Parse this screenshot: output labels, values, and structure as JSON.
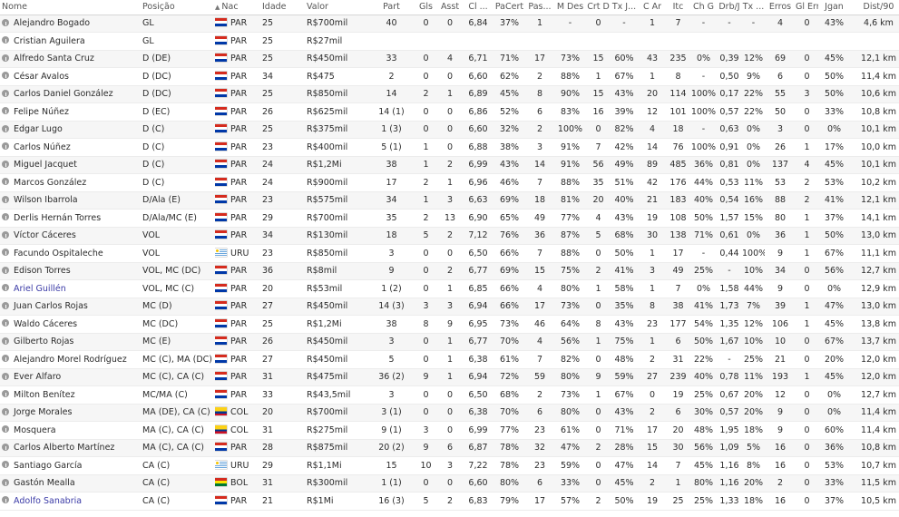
{
  "headers": {
    "nome": "Nome",
    "posicao": "Posição",
    "nac": "Nac",
    "idade": "Idade",
    "valor": "Valor",
    "part": "Part",
    "gls": "Gls",
    "asst": "Asst",
    "cl": "Cl ...",
    "pacert": "PaCert",
    "pas": "Pas...",
    "mdes": "M Des",
    "crt": "Crt D",
    "txj": "Tx J...",
    "car": "C Ar",
    "itc": "Itc",
    "chg": "Ch G",
    "drbj": "Drb/J",
    "tx": "Tx ...",
    "erros": "Erros",
    "glerr": "Gl Err",
    "jgan": "Jgan",
    "dist": "Dist/90"
  },
  "sort_icon": "sort-arrow-icon",
  "players": [
    {
      "name": "Alejandro Bogado",
      "pos": "GL",
      "flag": "par",
      "nat": "PAR",
      "age": "25",
      "value": "R$700mil",
      "apps": "40",
      "gls": "0",
      "asst": "0",
      "rating": "6,84",
      "pass_pct": "37%",
      "pas": "1",
      "mdes": "-",
      "crt": "0",
      "txj": "-",
      "car": "1",
      "itc": "7",
      "chg": "-",
      "drbj": "-",
      "tx": "-",
      "errors": "4",
      "glerr": "0",
      "won": "43%",
      "dist": "4,6 km",
      "link": false
    },
    {
      "name": "Cristian Aguilera",
      "pos": "GL",
      "flag": "par",
      "nat": "PAR",
      "age": "25",
      "value": "R$27mil",
      "apps": "",
      "gls": "",
      "asst": "",
      "rating": "",
      "pass_pct": "",
      "pas": "",
      "mdes": "",
      "crt": "",
      "txj": "",
      "car": "",
      "itc": "",
      "chg": "",
      "drbj": "",
      "tx": "",
      "errors": "",
      "glerr": "",
      "won": "",
      "dist": "",
      "link": false
    },
    {
      "name": "Alfredo Santa Cruz",
      "pos": "D (DE)",
      "flag": "par",
      "nat": "PAR",
      "age": "25",
      "value": "R$450mil",
      "apps": "33",
      "gls": "0",
      "asst": "4",
      "rating": "6,71",
      "pass_pct": "71%",
      "pas": "17",
      "mdes": "73%",
      "crt": "15",
      "txj": "60%",
      "car": "43",
      "itc": "235",
      "chg": "0%",
      "drbj": "0,39",
      "tx": "12%",
      "errors": "69",
      "glerr": "0",
      "won": "45%",
      "dist": "12,1 km",
      "link": false
    },
    {
      "name": "César Avalos",
      "pos": "D (DC)",
      "flag": "par",
      "nat": "PAR",
      "age": "34",
      "value": "R$475",
      "apps": "2",
      "gls": "0",
      "asst": "0",
      "rating": "6,60",
      "pass_pct": "62%",
      "pas": "2",
      "mdes": "88%",
      "crt": "1",
      "txj": "67%",
      "car": "1",
      "itc": "8",
      "chg": "-",
      "drbj": "0,50",
      "tx": "9%",
      "errors": "6",
      "glerr": "0",
      "won": "50%",
      "dist": "11,4 km",
      "link": false
    },
    {
      "name": "Carlos Daniel González",
      "pos": "D (DC)",
      "flag": "par",
      "nat": "PAR",
      "age": "25",
      "value": "R$850mil",
      "apps": "14",
      "gls": "2",
      "asst": "1",
      "rating": "6,89",
      "pass_pct": "45%",
      "pas": "8",
      "mdes": "90%",
      "crt": "15",
      "txj": "43%",
      "car": "20",
      "itc": "114",
      "chg": "100%",
      "drbj": "0,17",
      "tx": "22%",
      "errors": "55",
      "glerr": "3",
      "won": "50%",
      "dist": "10,6 km",
      "link": false
    },
    {
      "name": "Felipe Núñez",
      "pos": "D (EC)",
      "flag": "par",
      "nat": "PAR",
      "age": "26",
      "value": "R$625mil",
      "apps": "14 (1)",
      "gls": "0",
      "asst": "0",
      "rating": "6,86",
      "pass_pct": "52%",
      "pas": "6",
      "mdes": "83%",
      "crt": "16",
      "txj": "39%",
      "car": "12",
      "itc": "101",
      "chg": "100%",
      "drbj": "0,57",
      "tx": "22%",
      "errors": "50",
      "glerr": "0",
      "won": "33%",
      "dist": "10,8 km",
      "link": false
    },
    {
      "name": "Edgar Lugo",
      "pos": "D (C)",
      "flag": "par",
      "nat": "PAR",
      "age": "25",
      "value": "R$375mil",
      "apps": "1 (3)",
      "gls": "0",
      "asst": "0",
      "rating": "6,60",
      "pass_pct": "32%",
      "pas": "2",
      "mdes": "100%",
      "crt": "0",
      "txj": "82%",
      "car": "4",
      "itc": "18",
      "chg": "-",
      "drbj": "0,63",
      "tx": "0%",
      "errors": "3",
      "glerr": "0",
      "won": "0%",
      "dist": "10,1 km",
      "link": false
    },
    {
      "name": "Carlos Núñez",
      "pos": "D (C)",
      "flag": "par",
      "nat": "PAR",
      "age": "23",
      "value": "R$400mil",
      "apps": "5 (1)",
      "gls": "1",
      "asst": "0",
      "rating": "6,88",
      "pass_pct": "38%",
      "pas": "3",
      "mdes": "91%",
      "crt": "7",
      "txj": "42%",
      "car": "14",
      "itc": "76",
      "chg": "100%",
      "drbj": "0,91",
      "tx": "0%",
      "errors": "26",
      "glerr": "1",
      "won": "17%",
      "dist": "10,0 km",
      "link": false
    },
    {
      "name": "Miguel Jacquet",
      "pos": "D (C)",
      "flag": "par",
      "nat": "PAR",
      "age": "24",
      "value": "R$1,2Mi",
      "apps": "38",
      "gls": "1",
      "asst": "2",
      "rating": "6,99",
      "pass_pct": "43%",
      "pas": "14",
      "mdes": "91%",
      "crt": "56",
      "txj": "49%",
      "car": "89",
      "itc": "485",
      "chg": "36%",
      "drbj": "0,81",
      "tx": "0%",
      "errors": "137",
      "glerr": "4",
      "won": "45%",
      "dist": "10,1 km",
      "link": false
    },
    {
      "name": "Marcos González",
      "pos": "D (C)",
      "flag": "par",
      "nat": "PAR",
      "age": "24",
      "value": "R$900mil",
      "apps": "17",
      "gls": "2",
      "asst": "1",
      "rating": "6,96",
      "pass_pct": "46%",
      "pas": "7",
      "mdes": "88%",
      "crt": "35",
      "txj": "51%",
      "car": "42",
      "itc": "176",
      "chg": "44%",
      "drbj": "0,53",
      "tx": "11%",
      "errors": "53",
      "glerr": "2",
      "won": "53%",
      "dist": "10,2 km",
      "link": false
    },
    {
      "name": "Wilson Ibarrola",
      "pos": "D/Ala (E)",
      "flag": "par",
      "nat": "PAR",
      "age": "23",
      "value": "R$575mil",
      "apps": "34",
      "gls": "1",
      "asst": "3",
      "rating": "6,63",
      "pass_pct": "69%",
      "pas": "18",
      "mdes": "81%",
      "crt": "20",
      "txj": "40%",
      "car": "21",
      "itc": "183",
      "chg": "40%",
      "drbj": "0,54",
      "tx": "16%",
      "errors": "88",
      "glerr": "2",
      "won": "41%",
      "dist": "12,1 km",
      "link": false
    },
    {
      "name": "Derlis Hernán Torres",
      "pos": "D/Ala/MC (E)",
      "flag": "par",
      "nat": "PAR",
      "age": "29",
      "value": "R$700mil",
      "apps": "35",
      "gls": "2",
      "asst": "13",
      "rating": "6,90",
      "pass_pct": "65%",
      "pas": "49",
      "mdes": "77%",
      "crt": "4",
      "txj": "43%",
      "car": "19",
      "itc": "108",
      "chg": "50%",
      "drbj": "1,57",
      "tx": "15%",
      "errors": "80",
      "glerr": "1",
      "won": "37%",
      "dist": "14,1 km",
      "link": false
    },
    {
      "name": "Víctor Cáceres",
      "pos": "VOL",
      "flag": "par",
      "nat": "PAR",
      "age": "34",
      "value": "R$130mil",
      "apps": "18",
      "gls": "5",
      "asst": "2",
      "rating": "7,12",
      "pass_pct": "76%",
      "pas": "36",
      "mdes": "87%",
      "crt": "5",
      "txj": "68%",
      "car": "30",
      "itc": "138",
      "chg": "71%",
      "drbj": "0,61",
      "tx": "0%",
      "errors": "36",
      "glerr": "1",
      "won": "50%",
      "dist": "13,0 km",
      "link": false
    },
    {
      "name": "Facundo Ospitaleche",
      "pos": "VOL",
      "flag": "uru",
      "nat": "URU",
      "age": "23",
      "value": "R$850mil",
      "apps": "3",
      "gls": "0",
      "asst": "0",
      "rating": "6,50",
      "pass_pct": "66%",
      "pas": "7",
      "mdes": "88%",
      "crt": "0",
      "txj": "50%",
      "car": "1",
      "itc": "17",
      "chg": "-",
      "drbj": "0,44",
      "tx": "100%",
      "errors": "9",
      "glerr": "1",
      "won": "67%",
      "dist": "11,1 km",
      "link": false
    },
    {
      "name": "Edison Torres",
      "pos": "VOL, MC (DC)",
      "flag": "par",
      "nat": "PAR",
      "age": "36",
      "value": "R$8mil",
      "apps": "9",
      "gls": "0",
      "asst": "2",
      "rating": "6,77",
      "pass_pct": "69%",
      "pas": "15",
      "mdes": "75%",
      "crt": "2",
      "txj": "41%",
      "car": "3",
      "itc": "49",
      "chg": "25%",
      "drbj": "-",
      "tx": "10%",
      "errors": "34",
      "glerr": "0",
      "won": "56%",
      "dist": "12,7 km",
      "link": false
    },
    {
      "name": "Ariel Guillén",
      "pos": "VOL, MC (C)",
      "flag": "par",
      "nat": "PAR",
      "age": "20",
      "value": "R$53mil",
      "apps": "1 (2)",
      "gls": "0",
      "asst": "1",
      "rating": "6,85",
      "pass_pct": "66%",
      "pas": "4",
      "mdes": "80%",
      "crt": "1",
      "txj": "58%",
      "car": "1",
      "itc": "7",
      "chg": "0%",
      "drbj": "1,58",
      "tx": "44%",
      "errors": "9",
      "glerr": "0",
      "won": "0%",
      "dist": "12,9 km",
      "link": true
    },
    {
      "name": "Juan Carlos Rojas",
      "pos": "MC (D)",
      "flag": "par",
      "nat": "PAR",
      "age": "27",
      "value": "R$450mil",
      "apps": "14 (3)",
      "gls": "3",
      "asst": "3",
      "rating": "6,94",
      "pass_pct": "66%",
      "pas": "17",
      "mdes": "73%",
      "crt": "0",
      "txj": "35%",
      "car": "8",
      "itc": "38",
      "chg": "41%",
      "drbj": "1,73",
      "tx": "7%",
      "errors": "39",
      "glerr": "1",
      "won": "47%",
      "dist": "13,0 km",
      "link": false
    },
    {
      "name": "Waldo Cáceres",
      "pos": "MC (DC)",
      "flag": "par",
      "nat": "PAR",
      "age": "25",
      "value": "R$1,2Mi",
      "apps": "38",
      "gls": "8",
      "asst": "9",
      "rating": "6,95",
      "pass_pct": "73%",
      "pas": "46",
      "mdes": "64%",
      "crt": "8",
      "txj": "43%",
      "car": "23",
      "itc": "177",
      "chg": "54%",
      "drbj": "1,35",
      "tx": "12%",
      "errors": "106",
      "glerr": "1",
      "won": "45%",
      "dist": "13,8 km",
      "link": false
    },
    {
      "name": "Gilberto Rojas",
      "pos": "MC (E)",
      "flag": "par",
      "nat": "PAR",
      "age": "26",
      "value": "R$450mil",
      "apps": "3",
      "gls": "0",
      "asst": "1",
      "rating": "6,77",
      "pass_pct": "70%",
      "pas": "4",
      "mdes": "56%",
      "crt": "1",
      "txj": "75%",
      "car": "1",
      "itc": "6",
      "chg": "50%",
      "drbj": "1,67",
      "tx": "10%",
      "errors": "10",
      "glerr": "0",
      "won": "67%",
      "dist": "13,7 km",
      "link": false
    },
    {
      "name": "Alejandro Morel Rodríguez",
      "pos": "MC (C), MA (DC)",
      "flag": "par",
      "nat": "PAR",
      "age": "27",
      "value": "R$450mil",
      "apps": "5",
      "gls": "0",
      "asst": "1",
      "rating": "6,38",
      "pass_pct": "61%",
      "pas": "7",
      "mdes": "82%",
      "crt": "0",
      "txj": "48%",
      "car": "2",
      "itc": "31",
      "chg": "22%",
      "drbj": "-",
      "tx": "25%",
      "errors": "21",
      "glerr": "0",
      "won": "20%",
      "dist": "12,0 km",
      "link": false
    },
    {
      "name": "Ever Alfaro",
      "pos": "MC (C), CA (C)",
      "flag": "par",
      "nat": "PAR",
      "age": "31",
      "value": "R$475mil",
      "apps": "36 (2)",
      "gls": "9",
      "asst": "1",
      "rating": "6,94",
      "pass_pct": "72%",
      "pas": "59",
      "mdes": "80%",
      "crt": "9",
      "txj": "59%",
      "car": "27",
      "itc": "239",
      "chg": "40%",
      "drbj": "0,78",
      "tx": "11%",
      "errors": "193",
      "glerr": "1",
      "won": "45%",
      "dist": "12,0 km",
      "link": false
    },
    {
      "name": "Milton Benítez",
      "pos": "MC/MA (C)",
      "flag": "par",
      "nat": "PAR",
      "age": "33",
      "value": "R$43,5mil",
      "apps": "3",
      "gls": "0",
      "asst": "0",
      "rating": "6,50",
      "pass_pct": "68%",
      "pas": "2",
      "mdes": "73%",
      "crt": "1",
      "txj": "67%",
      "car": "0",
      "itc": "19",
      "chg": "25%",
      "drbj": "0,67",
      "tx": "20%",
      "errors": "12",
      "glerr": "0",
      "won": "0%",
      "dist": "12,7 km",
      "link": false
    },
    {
      "name": "Jorge Morales",
      "pos": "MA (DE), CA (C)",
      "flag": "col",
      "nat": "COL",
      "age": "20",
      "value": "R$700mil",
      "apps": "3 (1)",
      "gls": "0",
      "asst": "0",
      "rating": "6,38",
      "pass_pct": "70%",
      "pas": "6",
      "mdes": "80%",
      "crt": "0",
      "txj": "43%",
      "car": "2",
      "itc": "6",
      "chg": "30%",
      "drbj": "0,57",
      "tx": "20%",
      "errors": "9",
      "glerr": "0",
      "won": "0%",
      "dist": "11,4 km",
      "link": false
    },
    {
      "name": "Mosquera",
      "pos": "MA (C), CA (C)",
      "flag": "col",
      "nat": "COL",
      "age": "31",
      "value": "R$275mil",
      "apps": "9 (1)",
      "gls": "3",
      "asst": "0",
      "rating": "6,99",
      "pass_pct": "77%",
      "pas": "23",
      "mdes": "61%",
      "crt": "0",
      "txj": "71%",
      "car": "17",
      "itc": "20",
      "chg": "48%",
      "drbj": "1,95",
      "tx": "18%",
      "errors": "9",
      "glerr": "0",
      "won": "60%",
      "dist": "11,4 km",
      "link": false
    },
    {
      "name": "Carlos Alberto Martínez",
      "pos": "MA (C), CA (C)",
      "flag": "par",
      "nat": "PAR",
      "age": "28",
      "value": "R$875mil",
      "apps": "20 (2)",
      "gls": "9",
      "asst": "6",
      "rating": "6,87",
      "pass_pct": "78%",
      "pas": "32",
      "mdes": "47%",
      "crt": "2",
      "txj": "28%",
      "car": "15",
      "itc": "30",
      "chg": "56%",
      "drbj": "1,09",
      "tx": "5%",
      "errors": "16",
      "glerr": "0",
      "won": "36%",
      "dist": "10,8 km",
      "link": false
    },
    {
      "name": "Santiago García",
      "pos": "CA (C)",
      "flag": "uru",
      "nat": "URU",
      "age": "29",
      "value": "R$1,1Mi",
      "apps": "15",
      "gls": "10",
      "asst": "3",
      "rating": "7,22",
      "pass_pct": "78%",
      "pas": "23",
      "mdes": "59%",
      "crt": "0",
      "txj": "47%",
      "car": "14",
      "itc": "7",
      "chg": "45%",
      "drbj": "1,16",
      "tx": "8%",
      "errors": "16",
      "glerr": "0",
      "won": "53%",
      "dist": "10,7 km",
      "link": false
    },
    {
      "name": "Gastón Mealla",
      "pos": "CA (C)",
      "flag": "bol",
      "nat": "BOL",
      "age": "31",
      "value": "R$300mil",
      "apps": "1 (1)",
      "gls": "0",
      "asst": "0",
      "rating": "6,60",
      "pass_pct": "80%",
      "pas": "6",
      "mdes": "33%",
      "crt": "0",
      "txj": "45%",
      "car": "2",
      "itc": "1",
      "chg": "80%",
      "drbj": "1,16",
      "tx": "20%",
      "errors": "2",
      "glerr": "0",
      "won": "33%",
      "dist": "11,5 km",
      "link": false
    },
    {
      "name": "Adolfo Sanabria",
      "pos": "CA (C)",
      "flag": "par",
      "nat": "PAR",
      "age": "21",
      "value": "R$1Mi",
      "apps": "16 (3)",
      "gls": "5",
      "asst": "2",
      "rating": "6,83",
      "pass_pct": "79%",
      "pas": "17",
      "mdes": "57%",
      "crt": "2",
      "txj": "50%",
      "car": "19",
      "itc": "25",
      "chg": "25%",
      "drbj": "1,33",
      "tx": "18%",
      "errors": "16",
      "glerr": "0",
      "won": "37%",
      "dist": "10,5 km",
      "link": true
    }
  ]
}
